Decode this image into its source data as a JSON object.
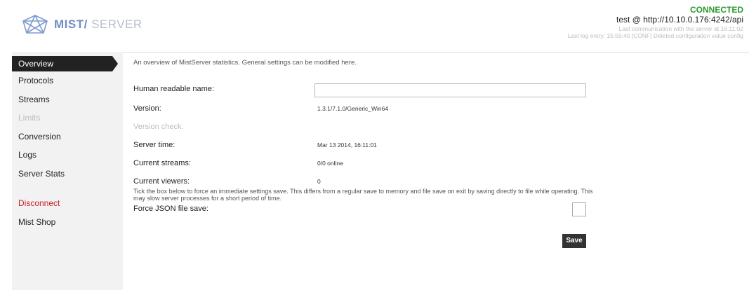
{
  "header": {
    "logo_mist": "MIST/",
    "logo_server": " SERVER",
    "status": "CONNECTED",
    "host": "test @ http://10.10.0.176:4242/api",
    "last_comm": "Last communication with the server at 16:11:02",
    "last_log": "Last log entry: 15:59:40 [CONF] Deleted configuration value config"
  },
  "nav": {
    "overview": "Overview",
    "protocols": "Protocols",
    "streams": "Streams",
    "limits": "Limits",
    "conversion": "Conversion",
    "logs": "Logs",
    "server_stats": "Server Stats",
    "disconnect": "Disconnect",
    "mist_shop": "Mist Shop"
  },
  "overview": {
    "intro": "An overview of MistServer statistics. General settings can be modified here.",
    "name_label": "Human readable name:",
    "name_value": "",
    "version_label": "Version:",
    "version_value": "1.3.1/7.1.0/Generic_Win64",
    "version_check_label": "Version check:",
    "server_time_label": "Server time:",
    "server_time_value": "Mar 13 2014, 16:11:01",
    "current_streams_label": "Current streams:",
    "current_streams_value": "0/0 online",
    "current_viewers_label": "Current viewers:",
    "current_viewers_value": "0",
    "force_note": "Tick the box below to force an immediate settings save. This differs from a regular save to memory and file save on exit by saving directly to file while operating. This may slow server processes for a short period of time.",
    "force_label": "Force JSON file save:",
    "force_checked": false,
    "save_label": "Save"
  },
  "colors": {
    "accent_blue": "#6f8fc2",
    "connected_green": "#2b9a2b",
    "disconnect_red": "#c8202a",
    "nav_active_bg": "#222222"
  }
}
